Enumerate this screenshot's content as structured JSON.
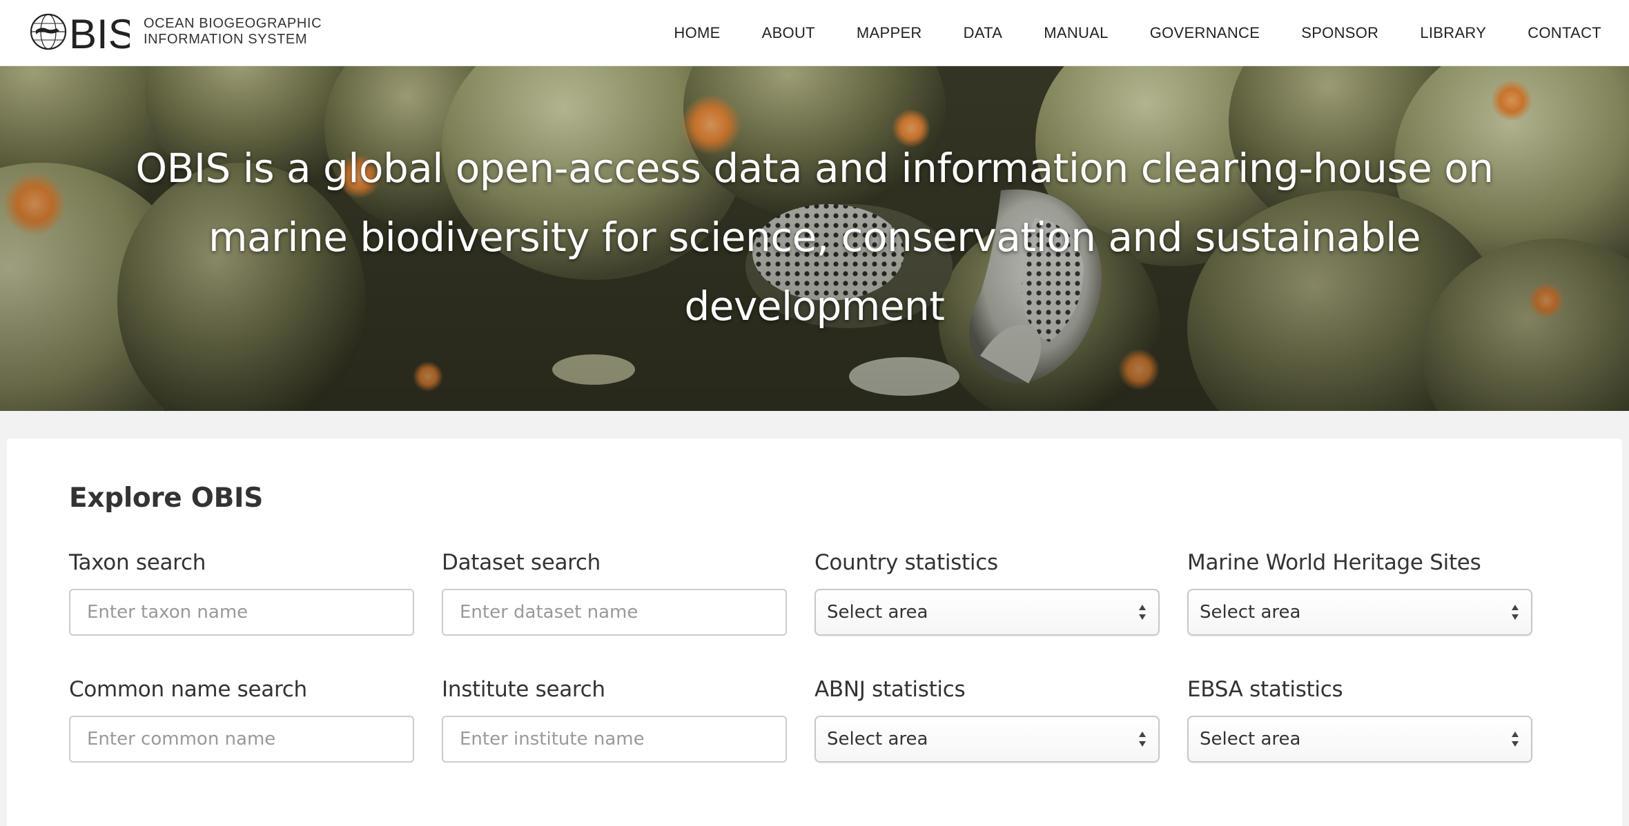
{
  "brand": {
    "logo_text": "OBIS",
    "name_line1": "OCEAN BIOGEOGRAPHIC",
    "name_line2": "INFORMATION SYSTEM"
  },
  "nav": {
    "items": [
      "HOME",
      "ABOUT",
      "MAPPER",
      "DATA",
      "MANUAL",
      "GOVERNANCE",
      "SPONSOR",
      "LIBRARY",
      "CONTACT"
    ]
  },
  "hero": {
    "tagline": "OBIS is a global open-access data and information clearing-house on marine biodiversity for science, conservation and sustainable development"
  },
  "explore": {
    "title": "Explore OBIS",
    "taxon": {
      "label": "Taxon search",
      "placeholder": "Enter taxon name"
    },
    "dataset": {
      "label": "Dataset search",
      "placeholder": "Enter dataset name"
    },
    "country": {
      "label": "Country statistics",
      "selected": "Select area"
    },
    "heritage": {
      "label": "Marine World Heritage Sites",
      "selected": "Select area"
    },
    "common": {
      "label": "Common name search",
      "placeholder": "Enter common name"
    },
    "institute": {
      "label": "Institute search",
      "placeholder": "Enter institute name"
    },
    "abnj": {
      "label": "ABNJ statistics",
      "selected": "Select area"
    },
    "ebsa": {
      "label": "EBSA statistics",
      "selected": "Select area"
    }
  },
  "colors": {
    "page_background": "#f2f2f2",
    "panel_background": "#ffffff",
    "text": "#333333",
    "input_border": "#cccccc"
  }
}
